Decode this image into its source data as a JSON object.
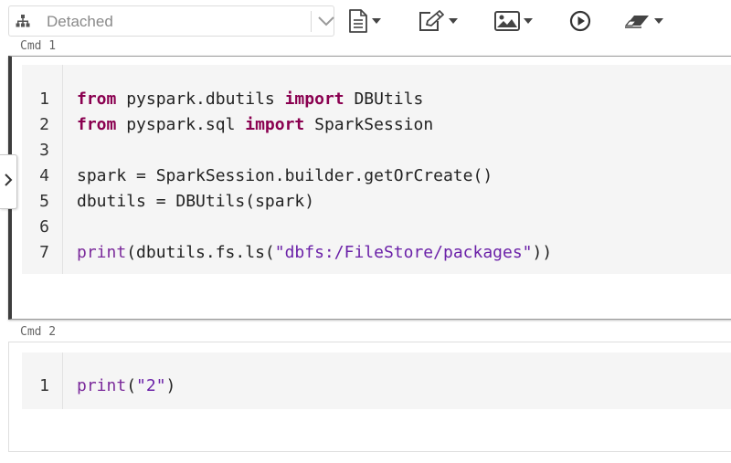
{
  "toolbar": {
    "cluster_status": "Detached",
    "icons": [
      "network-icon",
      "chevron-down-icon",
      "file-icon",
      "edit-icon",
      "image-icon",
      "play-circle-icon",
      "eraser-icon"
    ]
  },
  "cells": [
    {
      "label": "Cmd 1",
      "line_numbers": [
        "1",
        "2",
        "3",
        "4",
        "5",
        "6",
        "7"
      ],
      "lines": [
        {
          "kw1": "from",
          "t1": " pyspark.dbutils ",
          "kw2": "import",
          "t2": " DBUtils"
        },
        {
          "kw1": "from",
          "t1": " pyspark.sql ",
          "kw2": "import",
          "t2": " SparkSession"
        },
        {
          "text": ""
        },
        {
          "text": "spark = SparkSession.builder.getOrCreate()"
        },
        {
          "text": "dbutils = DBUtils(spark)"
        },
        {
          "text": ""
        },
        {
          "fn": "print",
          "a": "(dbutils.fs.ls(",
          "str": "\"dbfs:/FileStore/packages\"",
          "b": "))"
        }
      ]
    },
    {
      "label": "Cmd 2",
      "line_numbers": [
        "1"
      ],
      "lines": [
        {
          "fn": "print",
          "a": "(",
          "str": "\"2\"",
          "b": ")"
        }
      ]
    }
  ],
  "colors": {
    "keyword": "#8a0050",
    "builtin": "#7b2a9b",
    "string": "#6b21a8",
    "editor_bg": "#f5f5f5"
  }
}
